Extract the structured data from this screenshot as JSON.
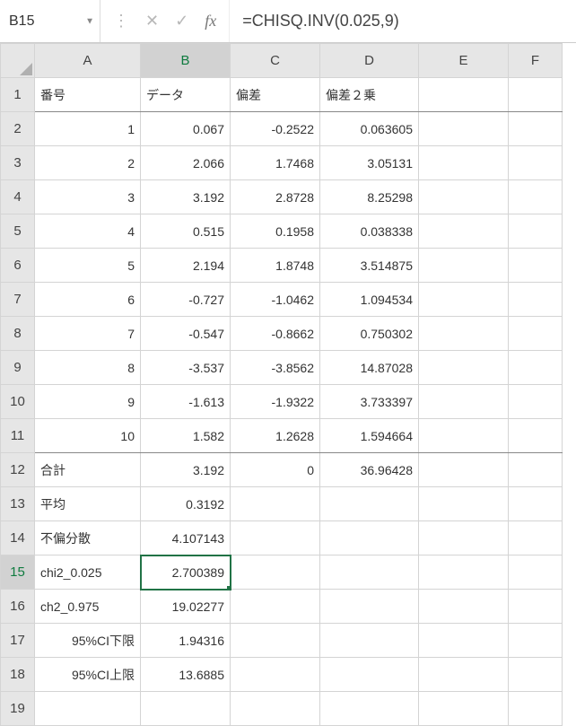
{
  "nameBox": "B15",
  "formula": "=CHISQ.INV(0.025,9)",
  "columns": [
    "A",
    "B",
    "C",
    "D",
    "E",
    "F"
  ],
  "headerRow": {
    "A": "番号",
    "B": "データ",
    "C": "偏差",
    "D": "偏差２乗"
  },
  "rows": [
    {
      "n": 2,
      "A": "1",
      "B": "0.067",
      "C": "-0.2522",
      "D": "0.063605"
    },
    {
      "n": 3,
      "A": "2",
      "B": "2.066",
      "C": "1.7468",
      "D": "3.05131"
    },
    {
      "n": 4,
      "A": "3",
      "B": "3.192",
      "C": "2.8728",
      "D": "8.25298"
    },
    {
      "n": 5,
      "A": "4",
      "B": "0.515",
      "C": "0.1958",
      "D": "0.038338"
    },
    {
      "n": 6,
      "A": "5",
      "B": "2.194",
      "C": "1.8748",
      "D": "3.514875"
    },
    {
      "n": 7,
      "A": "6",
      "B": "-0.727",
      "C": "-1.0462",
      "D": "1.094534"
    },
    {
      "n": 8,
      "A": "7",
      "B": "-0.547",
      "C": "-0.8662",
      "D": "0.750302"
    },
    {
      "n": 9,
      "A": "8",
      "B": "-3.537",
      "C": "-3.8562",
      "D": "14.87028"
    },
    {
      "n": 10,
      "A": "9",
      "B": "-1.613",
      "C": "-1.9322",
      "D": "3.733397"
    },
    {
      "n": 11,
      "A": "10",
      "B": "1.582",
      "C": "1.2628",
      "D": "1.594664"
    }
  ],
  "summary": [
    {
      "n": 12,
      "A": "合計",
      "B": "3.192",
      "C": "0",
      "D": "36.96428"
    },
    {
      "n": 13,
      "A": "平均",
      "B": "0.3192"
    },
    {
      "n": 14,
      "A": "不偏分散",
      "B": "4.107143"
    },
    {
      "n": 15,
      "A": "chi2_0.025",
      "B": "2.700389"
    },
    {
      "n": 16,
      "A": "ch2_0.975",
      "B": "19.02277"
    },
    {
      "n": 17,
      "A": "95%CI下限",
      "B": "1.94316"
    },
    {
      "n": 18,
      "A": "95%CI上限",
      "B": "13.6885"
    }
  ],
  "extraBlankRow": 19,
  "activeCell": {
    "row": 15,
    "col": "B"
  }
}
